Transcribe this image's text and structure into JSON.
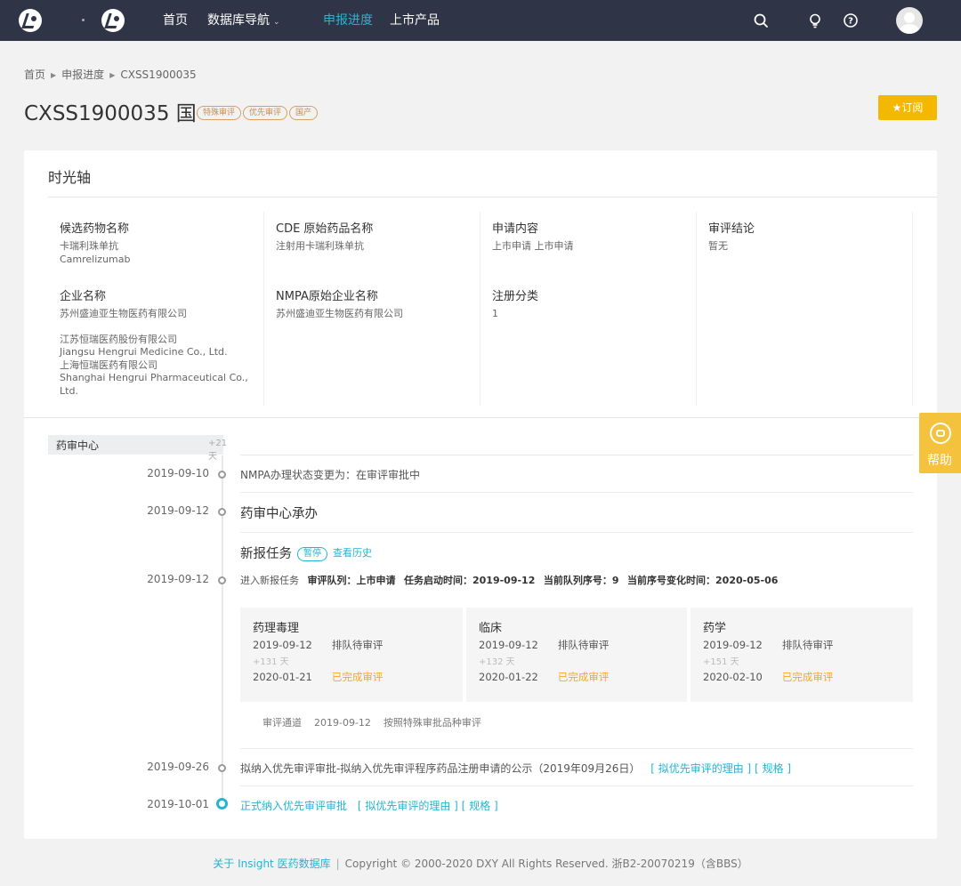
{
  "nav": {
    "home": "首页",
    "database": "数据库导航",
    "progress": "申报进度",
    "products": "上市产品"
  },
  "breadcrumb": [
    "首页",
    "申报进度",
    "CXSS1900035"
  ],
  "title": "CXSS1900035 国",
  "tags": [
    "特殊审评",
    "优先审评",
    "国产"
  ],
  "subscribe_label": "订阅",
  "section_title": "时光轴",
  "info": {
    "candidate_label": "候选药物名称",
    "candidate_cn": "卡瑞利珠单抗",
    "candidate_en": "Camrelizumab",
    "cde_label": "CDE 原始药品名称",
    "cde_value": "注射用卡瑞利珠单抗",
    "apply_label": "申请内容",
    "apply_value": "上市申请 上市申请",
    "conclusion_label": "审评结论",
    "conclusion_value": "暂无",
    "company_label": "企业名称",
    "company_1": "苏州盛迪亚生物医药有限公司",
    "company_2": "江苏恒瑞医药股份有限公司",
    "company_3": "Jiangsu Hengrui Medicine Co., Ltd.",
    "company_4": "上海恒瑞医药有限公司",
    "company_5": "Shanghai Hengrui Pharmaceutical Co., Ltd.",
    "nmpa_label": "NMPA原始企业名称",
    "nmpa_value": "苏州盛迪亚生物医药有限公司",
    "reg_label": "注册分类",
    "reg_value": "1"
  },
  "side_tab": {
    "label": "药审中心",
    "days": "+21天"
  },
  "timeline": {
    "e1_date": "2019-09-10",
    "e1_text": "NMPA办理状态变更为：在审评审批中",
    "e2_date": "2019-09-12",
    "e2_text": "药审中心承办",
    "task_title": "新报任务",
    "task_badge": "暂停",
    "task_history": "查看历史",
    "e3_date": "2019-09-12",
    "e3_prefix": "进入新报任务",
    "e3_queue_label": "审评队列：",
    "e3_queue_value": "上市申请",
    "e3_start_label": "任务启动时间：",
    "e3_start_value": "2019-09-12",
    "e3_seq_label": "当前队列序号：",
    "e3_seq_value": "9",
    "e3_change_label": "当前序号变化时间：",
    "e3_change_value": "2020-05-06",
    "e4_date": "2019-09-26",
    "e4_text": "拟纳入优先审评审批-拟纳入优先审评程序药品注册申请的公示（2019年09月26日）",
    "e4_link1": "[ 拟优先审评的理由 ]",
    "e4_link2": "[ 规格 ]",
    "e5_date": "2019-10-01",
    "e5_text": "正式纳入优先审评审批",
    "e5_link1": "[ 拟优先审评的理由 ]",
    "e5_link2": "[ 规格 ]"
  },
  "reviews": [
    {
      "title": "药理毒理",
      "start": "2019-09-12",
      "queued": "排队待审评",
      "days": "+131 天",
      "end": "2020-01-21",
      "done": "已完成审评"
    },
    {
      "title": "临床",
      "start": "2019-09-12",
      "queued": "排队待审评",
      "days": "+132 天",
      "end": "2020-01-22",
      "done": "已完成审评"
    },
    {
      "title": "药学",
      "start": "2019-09-12",
      "queued": "排队待审评",
      "days": "+151 天",
      "end": "2020-02-10",
      "done": "已完成审评"
    }
  ],
  "channel": {
    "label": "审评通道",
    "date": "2019-09-12",
    "desc": "按照特殊审批品种审评"
  },
  "help_label": "帮助",
  "footer": {
    "about": "关于 Insight 医药数据库",
    "copyright": "Copyright © 2000-2020 DXY All Rights Reserved. 浙B2-20070219（含BBS）"
  },
  "colors": {
    "nav_bg": "#2f3546",
    "accent": "#25b4d3",
    "subscribe": "#f5b800",
    "done": "#f5a623",
    "help": "#f5c23d"
  }
}
